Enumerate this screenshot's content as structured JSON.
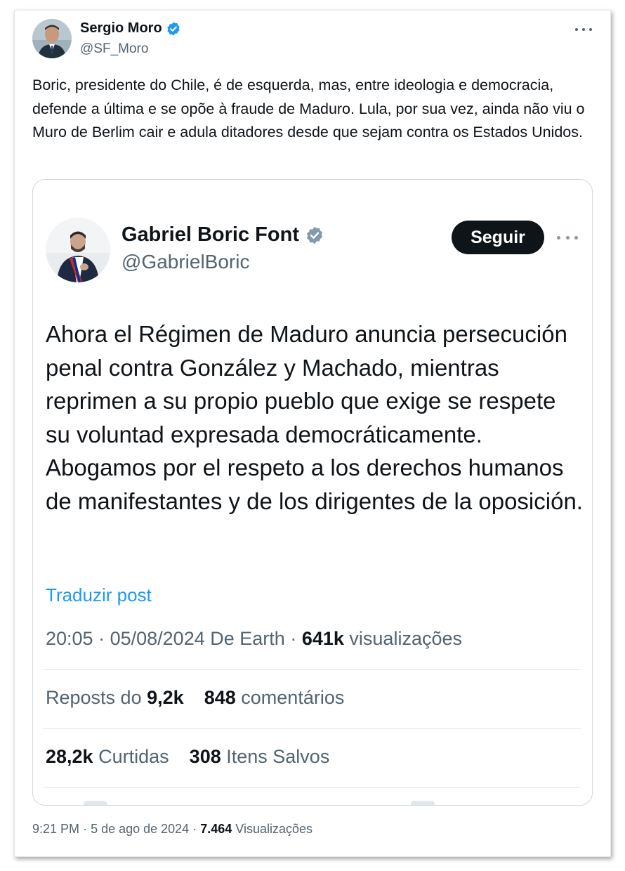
{
  "outer_post": {
    "author_name": "Sergio Moro",
    "author_handle": "@SF_Moro",
    "text": "Boric, presidente do Chile, é de esquerda, mas, entre ideologia e democracia, defende a última e se opõe à fraude de Maduro. Lula, por sua vez, ainda não viu o Muro de Berlim cair e adula ditadores desde que sejam contra os Estados Unidos.",
    "time": "9:21 PM",
    "date": "5 de ago de 2024",
    "views_count": "7.464",
    "views_label": "Visualizações"
  },
  "quoted_post": {
    "author_name": "Gabriel Boric Font",
    "author_handle": "@GabrielBoric",
    "follow_label": "Seguir",
    "text": "Ahora el Régimen de Maduro anuncia persecución penal contra González y Machado, mientras reprimen a su propio pueblo que exige se respete su voluntad expresada democráticamente. Abogamos por el respeto a los derechos humanos de manifestantes y de los dirigentes de la oposición.",
    "translate_label": "Traduzir post",
    "time": "20:05",
    "date": "05/08/2024",
    "source": "De Earth",
    "views_count": "641k",
    "views_label": "visualizações",
    "reposts_prefix": "Reposts do",
    "reposts_count": "9,2k",
    "comments_count": "848",
    "comments_label": "comentários",
    "likes_count": "28,2k",
    "likes_label": "Curtidas",
    "saves_count": "308",
    "saves_label": "Itens Salvos"
  },
  "icons": {
    "verified": "verified-badge-icon",
    "more": "more-horizontal-icon"
  },
  "colors": {
    "verified_blue": "#1d9bf0",
    "verified_gray": "#829aab",
    "link_blue": "#1d9bf0",
    "text_primary": "#0f1419",
    "text_secondary": "#536471"
  }
}
